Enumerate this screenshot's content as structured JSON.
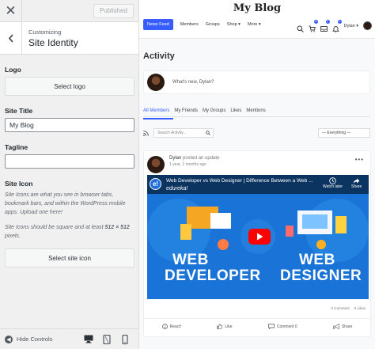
{
  "customizer": {
    "publish_label": "Published",
    "breadcrumb": "Customizing",
    "section_title": "Site Identity",
    "logo": {
      "label": "Logo",
      "button": "Select logo"
    },
    "site_title": {
      "label": "Site Title",
      "value": "My Blog"
    },
    "tagline": {
      "label": "Tagline",
      "value": ""
    },
    "site_icon": {
      "label": "Site Icon",
      "desc1": "Site Icons are what you see in browser tabs, bookmark bars, and within the WordPress mobile apps. Upload one here!",
      "desc2_prefix": "Site Icons should be square and at least ",
      "desc2_size": "512 × 512",
      "desc2_suffix": " pixels.",
      "button": "Select site icon"
    },
    "footer": {
      "hide_label": "Hide Controls"
    },
    "icons": [
      "close-icon",
      "chevron-left-icon",
      "desktop-icon",
      "tablet-icon",
      "mobile-icon",
      "arrow-left-circle-icon"
    ]
  },
  "preview": {
    "site_title": "My Blog",
    "nav": [
      "News Feed",
      "Members",
      "Groups",
      "Shop ▾",
      "More ▾"
    ],
    "user_name": "Dylan ▾",
    "badges": {
      "messages": "0",
      "notifications": "0",
      "cart": "0"
    },
    "activity_heading": "Activity",
    "whats_new": "What's new, Dylan?",
    "tabs": [
      "All Members",
      "My Friends",
      "My Groups",
      "Likes",
      "Mentions"
    ],
    "search_placeholder": "Search Activity...",
    "filter_select": "— Everything —",
    "post": {
      "author": "Dylan",
      "action": " posted an update",
      "time": "1 year, 2 months ago",
      "video_title": "Web Developer vs Web Designer | Difference Between a Web ...",
      "channel": "edureka!",
      "logo_letter": "e!",
      "watch_later": "Watch later",
      "share": "Share",
      "big_left_1": "WEB",
      "big_left_2": "DEVELOPER",
      "big_right_1": "WEB",
      "big_right_2": "DESIGNER",
      "comments": "0 Comment",
      "likes": "0 Likes"
    },
    "actions": {
      "react": "React!",
      "like": "Like",
      "comment": "Comment 0",
      "share": "Share"
    },
    "accent": "#385dff"
  }
}
